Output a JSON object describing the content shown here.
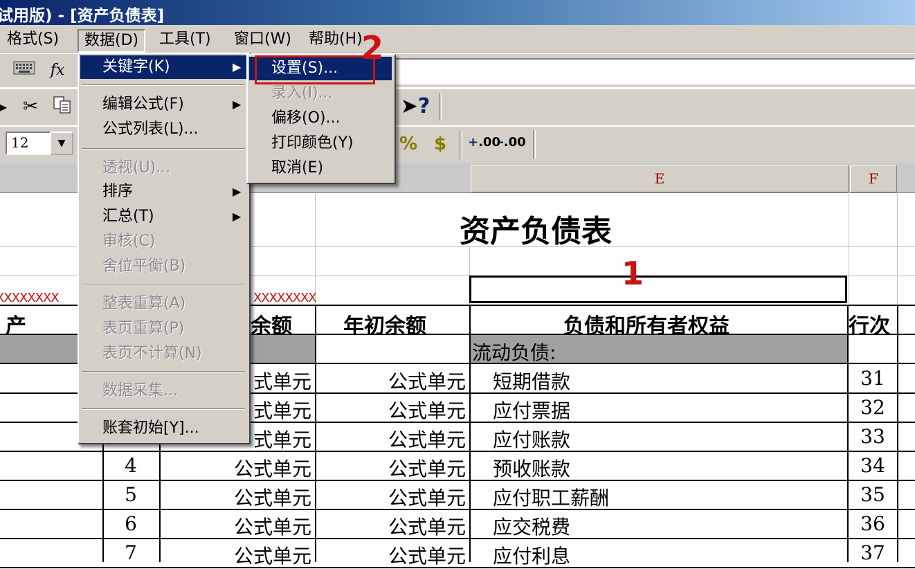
{
  "window": {
    "title": "试用版) - [资产负债表]"
  },
  "menubar": [
    "格式(S)",
    "数据(D)",
    "工具(T)",
    "窗口(W)",
    "帮助(H)"
  ],
  "formula_bar": {
    "fx": "fx"
  },
  "toolbar": {
    "font_size": "12",
    "percent": "%",
    "currency": "$",
    "inc_decimal": ".00",
    "dec_decimal": ".00",
    "help_icon": "?"
  },
  "columns": {
    "E": "E",
    "F": "F"
  },
  "sheet": {
    "title": "资产负债表",
    "x_marks_left": "XXXXXXXX",
    "x_marks_right": "XXXXXXXX",
    "headers": {
      "asset": "产",
      "end_balance": "余额",
      "begin_balance": "年初余额",
      "liabilities": "负债和所有者权益",
      "line_no": "行次"
    },
    "section": "流动负债:",
    "rows": [
      {
        "line": "",
        "end": "式单元",
        "begin": "公式单元",
        "item": "短期借款",
        "no": "31"
      },
      {
        "line": "",
        "end": "式单元",
        "begin": "公式单元",
        "item": "应付票据",
        "no": "32"
      },
      {
        "line": "",
        "end": "式单元",
        "begin": "公式单元",
        "item": "应付账款",
        "no": "33"
      },
      {
        "line": "4",
        "end": "公式单元",
        "begin": "公式单元",
        "item": "预收账款",
        "no": "34"
      },
      {
        "line": "5",
        "end": "公式单元",
        "begin": "公式单元",
        "item": "应付职工薪酬",
        "no": "35"
      },
      {
        "line": "6",
        "end": "公式单元",
        "begin": "公式单元",
        "item": "应交税费",
        "no": "36"
      },
      {
        "line": "7",
        "end": "公式单元",
        "begin": "公式单元",
        "item": "应付利息",
        "no": "37"
      }
    ]
  },
  "data_menu": {
    "items": [
      {
        "label": "关键字(K)",
        "state": "selected",
        "submenu": true
      },
      {
        "label": "编辑公式(F)",
        "state": "enabled",
        "submenu": true
      },
      {
        "label": "公式列表(L)...",
        "state": "enabled"
      },
      {
        "label": "透视(U)...",
        "state": "disabled"
      },
      {
        "label": "排序",
        "state": "enabled",
        "submenu": true
      },
      {
        "label": "汇总(T)",
        "state": "enabled",
        "submenu": true
      },
      {
        "label": "审核(C)",
        "state": "disabled"
      },
      {
        "label": "舍位平衡(B)",
        "state": "disabled"
      },
      {
        "label": "整表重算(A)",
        "state": "disabled"
      },
      {
        "label": "表页重算(P)",
        "state": "disabled"
      },
      {
        "label": "表页不计算(N)",
        "state": "disabled"
      },
      {
        "label": "数据采集...",
        "state": "disabled"
      },
      {
        "label": "账套初始[Y]...",
        "state": "enabled"
      }
    ]
  },
  "keyword_submenu": {
    "items": [
      {
        "label": "设置(S)...",
        "state": "selected"
      },
      {
        "label": "录入(I)...",
        "state": "disabled"
      },
      {
        "label": "偏移(O)...",
        "state": "enabled"
      },
      {
        "label": "打印颜色(Y)",
        "state": "enabled"
      },
      {
        "label": "取消(E)",
        "state": "enabled"
      }
    ]
  },
  "annotations": {
    "step1": "1",
    "step2": "2"
  },
  "colors": {
    "menu_highlight": "#0a246a",
    "annotation": "#c81414",
    "column_letter": "#990000"
  }
}
